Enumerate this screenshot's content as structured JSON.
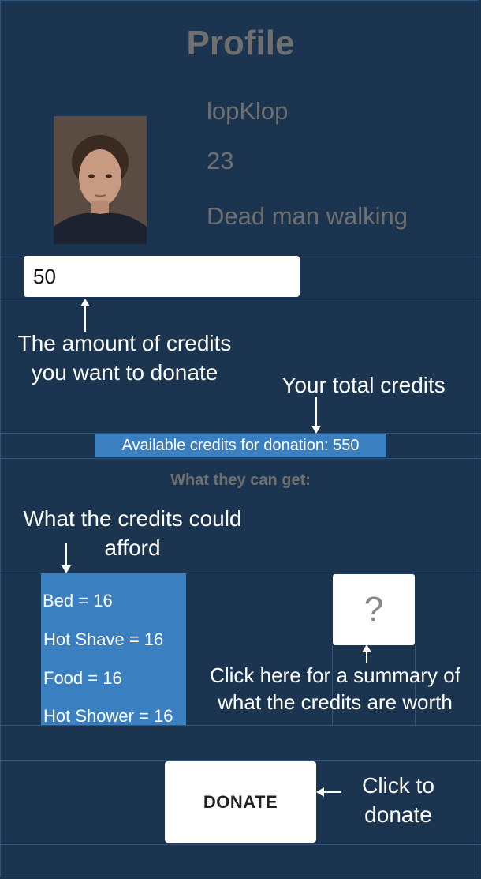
{
  "page": {
    "title": "Profile"
  },
  "profile": {
    "username": "lopKlop",
    "age": "23",
    "status": "Dead man walking",
    "photo_icon": "person-photo"
  },
  "donation": {
    "amount_value": "50",
    "available_credits_label": "Available credits for donation: 550",
    "subheading": "What they can get:",
    "items": [
      {
        "label": "Bed  = 16"
      },
      {
        "label": "Hot Shave  = 16"
      },
      {
        "label": "Food  = 16"
      },
      {
        "label": "Hot Shower  = 16"
      }
    ],
    "help_icon": "question-mark-icon",
    "help_symbol": "?",
    "donate_label": "DONATE"
  },
  "annotations": {
    "amount_line1": "The amount of credits",
    "amount_line2": "you want to donate",
    "total": "Your total credits",
    "afford_line1": "What the credits could",
    "afford_line2": "afford",
    "summary_line1": "Click here for a summary of",
    "summary_line2": "what the credits are worth",
    "donate_line1": "Click to",
    "donate_line2": "donate"
  },
  "colors": {
    "background": "#1b3550",
    "accent": "#3a7fc0",
    "muted_text": "#6f6f6f"
  }
}
